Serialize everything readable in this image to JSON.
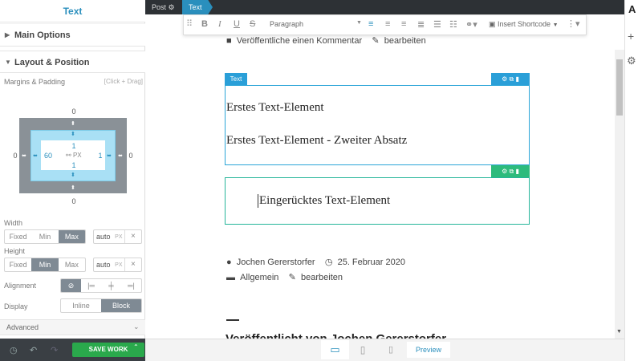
{
  "panel": {
    "title": "Text",
    "sections": {
      "main": "Main Options",
      "layout": "Layout & Position",
      "advanced": "Advanced"
    },
    "margins_label": "Margins & Padding",
    "margins_hint": "[Click + Drag]",
    "box": {
      "margin_top": "0",
      "margin_bottom": "0",
      "margin_left": "0",
      "margin_right": "0",
      "padding_top": "1",
      "padding_bottom": "1",
      "padding_left": "60",
      "padding_right": "1",
      "unit": "PX"
    },
    "width_label": "Width",
    "width_options": [
      "Fixed",
      "Min",
      "Max"
    ],
    "width_value": "auto",
    "width_unit": "PX",
    "height_label": "Height",
    "height_options": [
      "Fixed",
      "Min",
      "Max"
    ],
    "height_value": "auto",
    "height_unit": "PX",
    "alignment_label": "Alignment",
    "alignment_options": [
      "⊘",
      "|═",
      "╪",
      "═|"
    ],
    "display_label": "Display",
    "display_options": [
      "Inline",
      "Block"
    ],
    "save_label": "SAVE WORK"
  },
  "topbar": {
    "post_label": "Post",
    "text_tab": "Text"
  },
  "toolbar": {
    "paragraph": "Paragraph",
    "shortcode": "Insert Shortcode"
  },
  "content": {
    "comment_link": "Veröffentliche einen Kommentar",
    "edit_link": "bearbeiten",
    "el_tag": "Text",
    "p1": "Erstes Text-Element",
    "p2": "Erstes Text-Element - Zweiter Absatz",
    "p3": "Eingerücktes Text-Element",
    "author": "Jochen Gererstorfer",
    "date": "25. Februar 2020",
    "category": "Allgemein",
    "edit2": "bearbeiten",
    "bottom_cut": "Veröffentlicht von Jochen Gererstorfer"
  },
  "bottombar": {
    "preview": "Preview"
  },
  "colors": {
    "accent": "#2a8fbd",
    "green": "#2aa94c",
    "element_outline": "#2ba5d8",
    "element_outline_active": "#26b59a"
  }
}
